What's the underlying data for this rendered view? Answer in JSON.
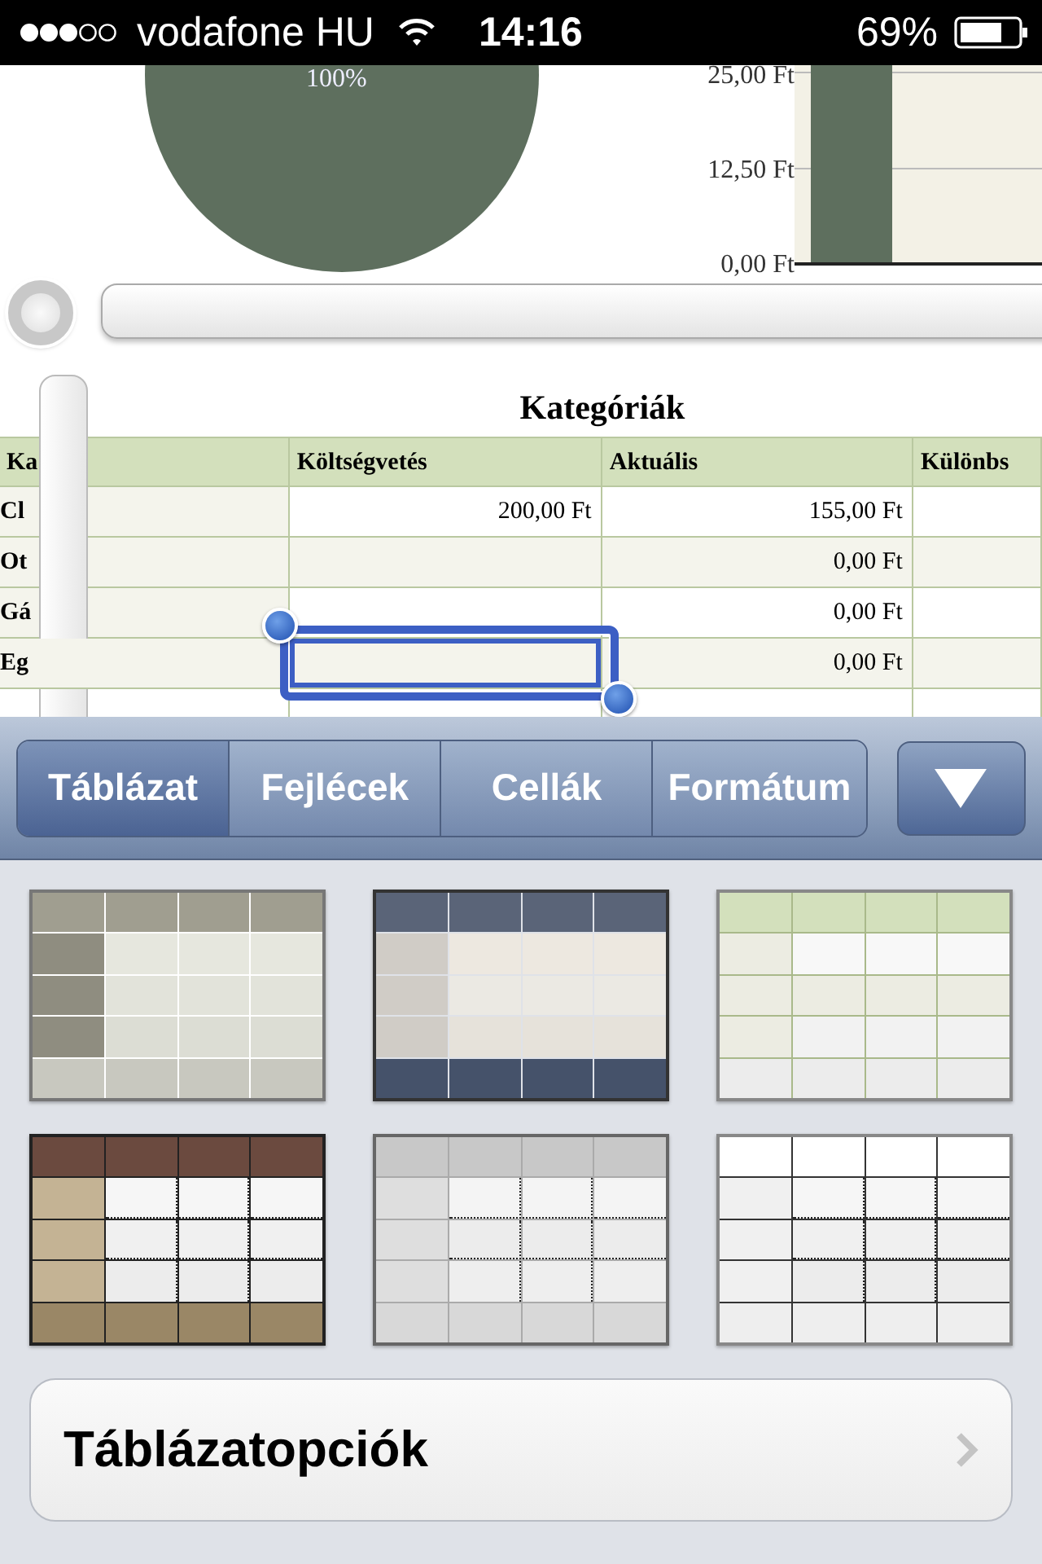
{
  "status_bar": {
    "carrier": "vodafone HU",
    "time": "14:16",
    "battery": "69%"
  },
  "charts": {
    "pie": {
      "label": "100%"
    },
    "bar": {
      "y_labels": [
        "25,00 Ft",
        "12,50 Ft",
        "0,00 Ft"
      ]
    }
  },
  "table": {
    "title": "Kategóriák",
    "columns": [
      "Ka",
      "Költségvetés",
      "Aktuális",
      "Különbs"
    ],
    "rows": [
      {
        "category": "Cl",
        "budget": "200,00 Ft",
        "actual": "155,00 Ft",
        "selected": false
      },
      {
        "category": "Ot",
        "actual": "0,00 Ft",
        "selected": false
      },
      {
        "category": "Gá",
        "actual": "0,00 Ft",
        "selected": false
      },
      {
        "category": "Eg",
        "actual": "0,00 Ft",
        "selected": true
      }
    ]
  },
  "toolbar": {
    "tabs": [
      {
        "label": "Táblázat",
        "selected": true
      },
      {
        "label": "Fejlécek",
        "selected": false
      },
      {
        "label": "Cellák",
        "selected": false
      },
      {
        "label": "Formátum",
        "selected": false
      }
    ]
  },
  "styles": [
    {
      "kind": "gray"
    },
    {
      "kind": "slate"
    },
    {
      "kind": "green"
    },
    {
      "kind": "brown"
    },
    {
      "kind": "silver"
    },
    {
      "kind": "open"
    }
  ],
  "options_button": {
    "label": "Táblázatopciók"
  }
}
